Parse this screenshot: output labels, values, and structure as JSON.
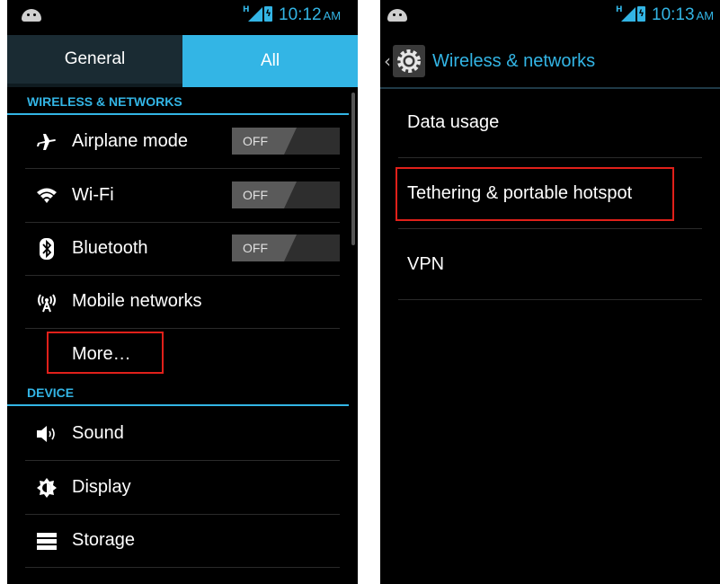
{
  "left": {
    "status": {
      "time": "10:12",
      "ampm": "AM",
      "network": "H"
    },
    "tabs": [
      {
        "label": "General"
      },
      {
        "label": "All"
      }
    ],
    "sections": {
      "wireless": "WIRELESS & NETWORKS",
      "device": "DEVICE"
    },
    "wireless_items": [
      {
        "label": "Airplane mode",
        "toggle": "OFF",
        "icon": "airplane-icon"
      },
      {
        "label": "Wi-Fi",
        "toggle": "OFF",
        "icon": "wifi-icon"
      },
      {
        "label": "Bluetooth",
        "toggle": "OFF",
        "icon": "bluetooth-icon"
      },
      {
        "label": "Mobile networks",
        "icon": "mobile-network-icon"
      },
      {
        "label": "More…"
      }
    ],
    "device_items": [
      {
        "label": "Sound",
        "icon": "sound-icon"
      },
      {
        "label": "Display",
        "icon": "display-icon"
      },
      {
        "label": "Storage",
        "icon": "storage-icon"
      }
    ]
  },
  "right": {
    "status": {
      "time": "10:13",
      "ampm": "AM",
      "network": "H"
    },
    "actionbar": {
      "title": "Wireless & networks",
      "icon": "settings-gear-icon"
    },
    "items": [
      {
        "label": "Data usage"
      },
      {
        "label": "Tethering & portable hotspot"
      },
      {
        "label": "VPN"
      }
    ]
  },
  "colors": {
    "accent": "#33b5e5",
    "highlight": "#e0201a",
    "background": "#000000"
  }
}
